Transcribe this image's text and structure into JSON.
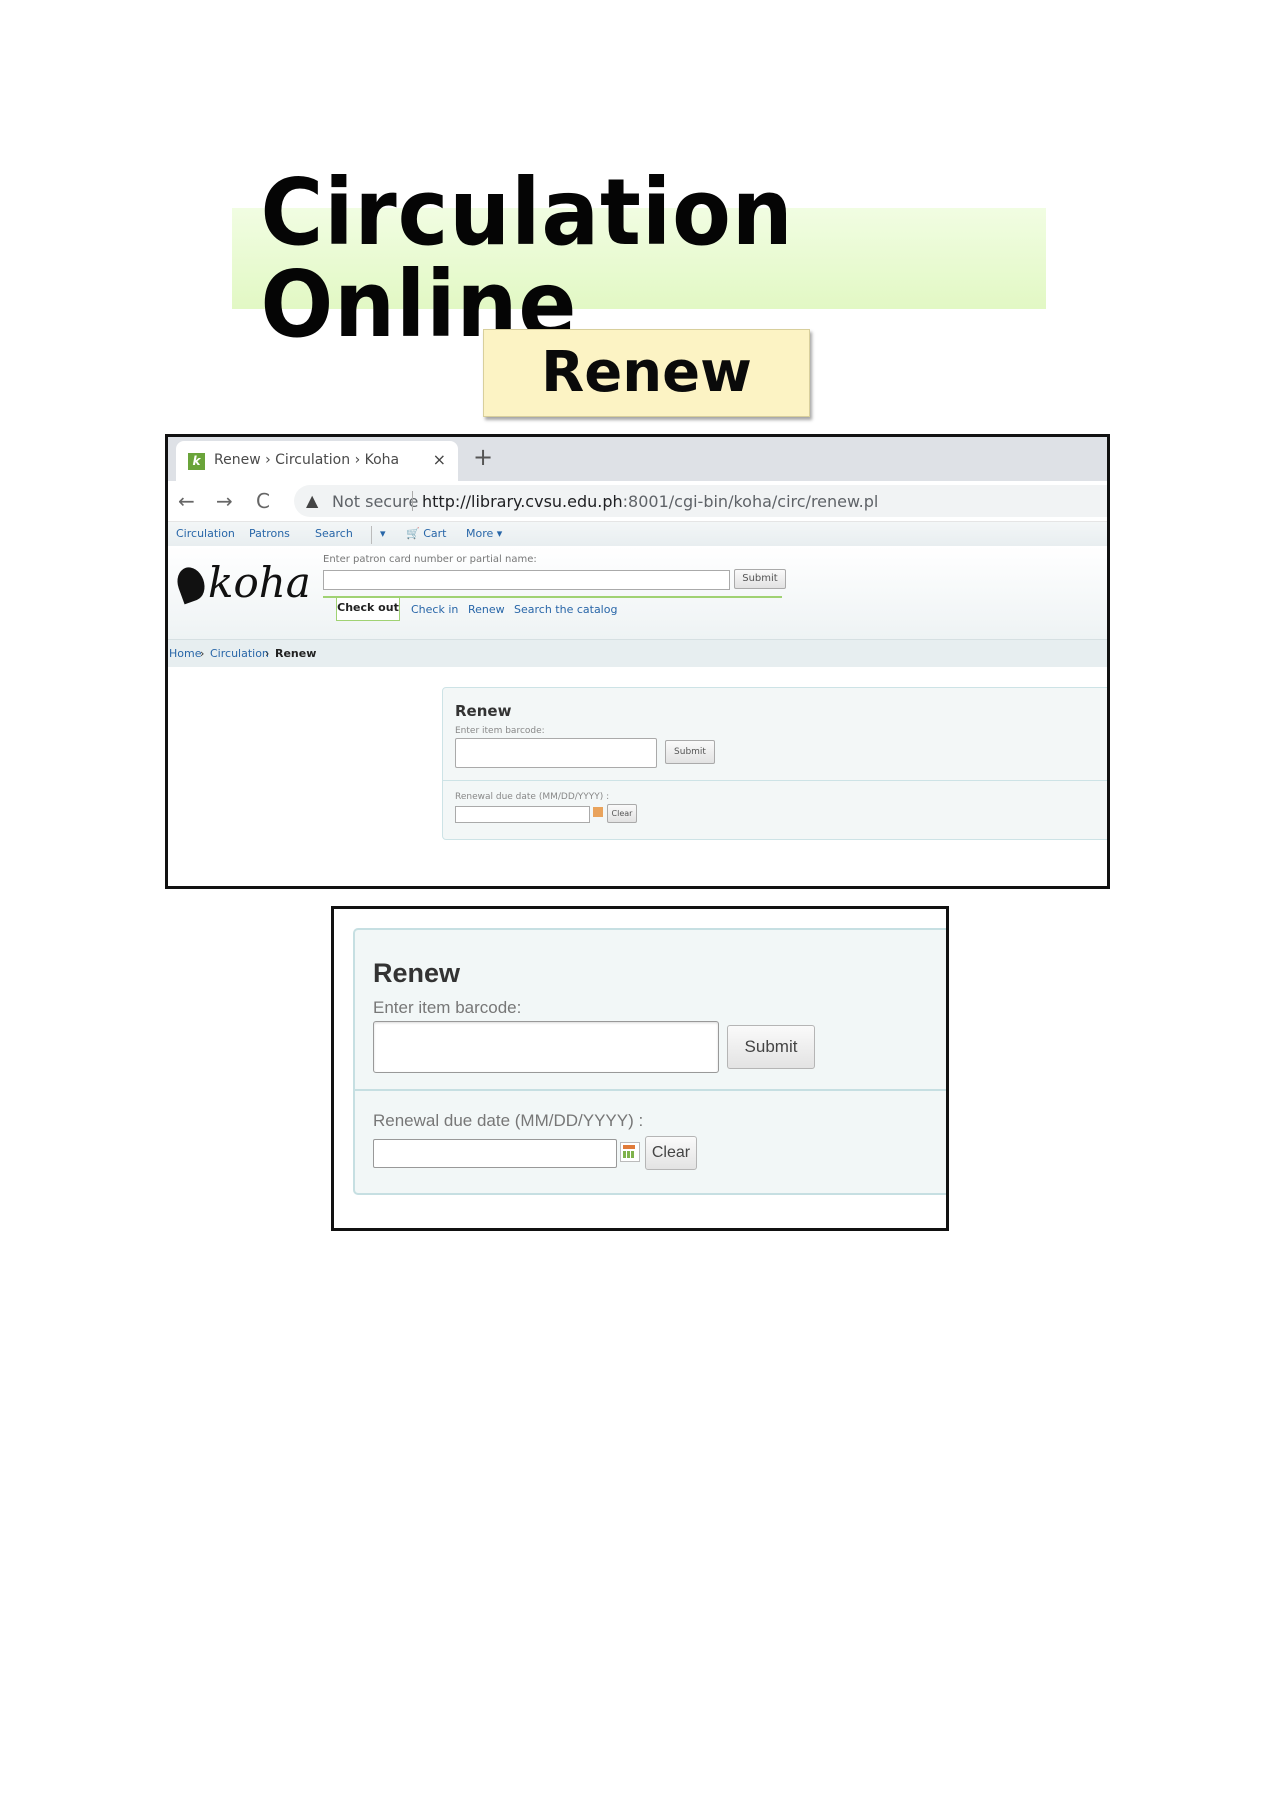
{
  "doc": {
    "title": "Circulation Online",
    "subtitle": "Renew"
  },
  "browser": {
    "tab_title": "Renew › Circulation › Koha",
    "favicon": "k",
    "close_symbol": "×",
    "new_tab_symbol": "+",
    "back_icon": "←",
    "forward_icon": "→",
    "reload_icon": "C",
    "warning_icon": "▲",
    "not_secure": "Not secure",
    "url_host": "http://library.cvsu.edu.ph",
    "url_path": ":8001/cgi-bin/koha/circ/renew.pl"
  },
  "koha": {
    "nav": [
      "Circulation",
      "Patrons",
      "Search",
      "▾",
      "Cart",
      "More ▾"
    ],
    "logo": "koha",
    "patron_label": "Enter patron card number or partial name:",
    "patron_submit": "Submit",
    "tabs": {
      "checkout": "Check out",
      "checkin": "Check in",
      "renew": "Renew",
      "search": "Search the catalog"
    },
    "breadcrumb": {
      "home": "Home",
      "sep": "›",
      "circulation": "Circulation",
      "current": "Renew"
    }
  },
  "renew_form": {
    "heading": "Renew",
    "barcode_label": "Enter item barcode:",
    "barcode_value": "",
    "submit_label": "Submit",
    "due_date_label": "Renewal due date (MM/DD/YYYY) :",
    "due_date_value": "",
    "clear_label": "Clear"
  }
}
